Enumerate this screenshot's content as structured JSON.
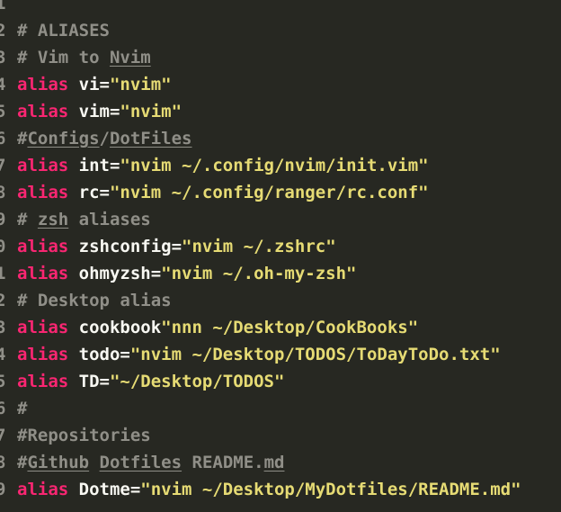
{
  "colors": {
    "background": "#272822",
    "keyword": "#f92672",
    "string": "#e6db74",
    "comment": "#908f88",
    "text": "#f8f8f2"
  },
  "lines": [
    {
      "num": "1",
      "segments": []
    },
    {
      "num": "2",
      "segments": [
        {
          "t": "# ALIASES",
          "c": "cmt"
        }
      ]
    },
    {
      "num": "3",
      "segments": [
        {
          "t": "# Vim to ",
          "c": "cmt"
        },
        {
          "t": "Nvim",
          "c": "cmt ul"
        }
      ]
    },
    {
      "num": "4",
      "segments": [
        {
          "t": "alias",
          "c": "kw"
        },
        {
          "t": " vi=",
          "c": "plain"
        },
        {
          "t": "\"nvim\"",
          "c": "str"
        }
      ]
    },
    {
      "num": "5",
      "segments": [
        {
          "t": "alias",
          "c": "kw"
        },
        {
          "t": " vim=",
          "c": "plain"
        },
        {
          "t": "\"nvim\"",
          "c": "str"
        }
      ]
    },
    {
      "num": "6",
      "segments": [
        {
          "t": "#",
          "c": "cmt"
        },
        {
          "t": "Configs",
          "c": "cmt ul"
        },
        {
          "t": "/",
          "c": "cmt"
        },
        {
          "t": "DotFiles",
          "c": "cmt ul"
        }
      ]
    },
    {
      "num": "7",
      "segments": [
        {
          "t": "alias",
          "c": "kw"
        },
        {
          "t": " int=",
          "c": "plain"
        },
        {
          "t": "\"nvim ~/.config/nvim/init.vim\"",
          "c": "str"
        }
      ]
    },
    {
      "num": "8",
      "segments": [
        {
          "t": "alias",
          "c": "kw"
        },
        {
          "t": " rc=",
          "c": "plain"
        },
        {
          "t": "\"nvim ~/.config/ranger/rc.conf\"",
          "c": "str"
        }
      ]
    },
    {
      "num": "9",
      "segments": [
        {
          "t": "# ",
          "c": "cmt"
        },
        {
          "t": "zsh",
          "c": "cmt ul"
        },
        {
          "t": " aliases",
          "c": "cmt"
        }
      ]
    },
    {
      "num": "0",
      "segments": [
        {
          "t": "alias",
          "c": "kw"
        },
        {
          "t": " zshconfig=",
          "c": "plain"
        },
        {
          "t": "\"nvim ~/.zshrc\"",
          "c": "str"
        }
      ]
    },
    {
      "num": "1",
      "segments": [
        {
          "t": "alias",
          "c": "kw"
        },
        {
          "t": " ohmyzsh=",
          "c": "plain"
        },
        {
          "t": "\"nvim ~/.oh-my-zsh\"",
          "c": "str"
        }
      ]
    },
    {
      "num": "2",
      "segments": [
        {
          "t": "# Desktop alias",
          "c": "cmt"
        }
      ]
    },
    {
      "num": "3",
      "segments": [
        {
          "t": "alias",
          "c": "kw"
        },
        {
          "t": " cookbook",
          "c": "plain"
        },
        {
          "t": "\"nnn ~/Desktop/CookBooks\"",
          "c": "str"
        }
      ]
    },
    {
      "num": "4",
      "segments": [
        {
          "t": "alias",
          "c": "kw"
        },
        {
          "t": " todo=",
          "c": "plain"
        },
        {
          "t": "\"nvim ~/Desktop/TODOS/ToDayToDo.txt\"",
          "c": "str"
        }
      ]
    },
    {
      "num": "5",
      "segments": [
        {
          "t": "alias",
          "c": "kw"
        },
        {
          "t": " TD=",
          "c": "plain"
        },
        {
          "t": "\"~/Desktop/TODOS\"",
          "c": "str"
        }
      ]
    },
    {
      "num": "6",
      "segments": [
        {
          "t": "#",
          "c": "cmt"
        }
      ]
    },
    {
      "num": "7",
      "segments": [
        {
          "t": "#Repositories",
          "c": "cmt"
        }
      ]
    },
    {
      "num": "8",
      "segments": [
        {
          "t": "#",
          "c": "cmt"
        },
        {
          "t": "Github",
          "c": "cmt ul"
        },
        {
          "t": " ",
          "c": "cmt"
        },
        {
          "t": "Dotfiles",
          "c": "cmt ul"
        },
        {
          "t": " README.",
          "c": "cmt"
        },
        {
          "t": "md",
          "c": "cmt ul"
        }
      ]
    },
    {
      "num": "9",
      "segments": [
        {
          "t": "alias",
          "c": "kw"
        },
        {
          "t": " Dotme=",
          "c": "plain"
        },
        {
          "t": "\"nvim ~/Desktop/MyDotfiles/README.md\"",
          "c": "str"
        }
      ]
    }
  ]
}
